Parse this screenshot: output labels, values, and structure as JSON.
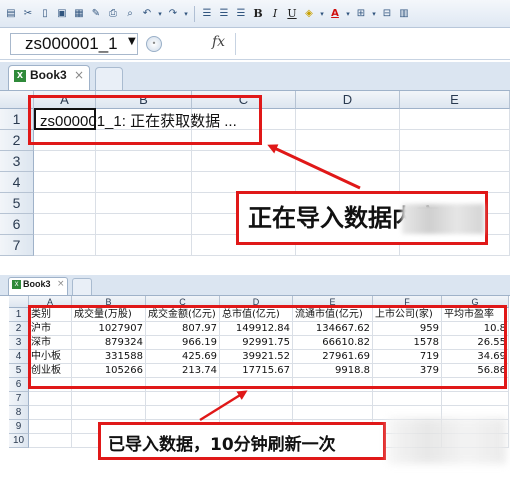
{
  "toolbar": {
    "icons": [
      "paste-icon",
      "cut-icon",
      "new-icon",
      "save-icon",
      "print-preview-icon",
      "format-painter-icon",
      "print-icon",
      "preview-icon",
      "undo-icon",
      "redo-icon",
      "align-left-icon",
      "align-center-icon",
      "align-right-icon",
      "bold-icon",
      "italic-icon",
      "underline-icon",
      "fill-color-icon",
      "font-color-icon",
      "borders-icon",
      "merge-icon",
      "more-icon"
    ],
    "bold": "B",
    "italic": "I",
    "underline": "U",
    "font_color_letter": "A"
  },
  "formula_bar": {
    "name_box": "zs000001_1",
    "fx": "fx",
    "formula": ""
  },
  "top_window": {
    "tab_label": "Book3",
    "tab_close": "×",
    "columns": [
      "A",
      "B",
      "C",
      "D",
      "E"
    ],
    "rows": [
      "1",
      "2",
      "3",
      "4",
      "5",
      "6",
      "7"
    ],
    "cell_text": "zs000001_1: 正在获取数据 ...",
    "callout": "正在导入数据内容"
  },
  "bottom_window": {
    "tab_label": "Book3",
    "tab_close": "×",
    "columns": [
      "A",
      "B",
      "C",
      "D",
      "E",
      "F",
      "G"
    ],
    "rows": [
      "1",
      "2",
      "3",
      "4",
      "5",
      "6",
      "7",
      "8",
      "9",
      "10"
    ],
    "headers": [
      "类别",
      "成交量(万股)",
      "成交金额(亿元)",
      "总市值(亿元)",
      "流通市值(亿元)",
      "上市公司(家)",
      "平均市盈率"
    ],
    "data": [
      [
        "沪市",
        "1027907",
        "807.97",
        "149912.84",
        "134667.62",
        "959",
        "10.8"
      ],
      [
        "深市",
        "879324",
        "966.19",
        "92991.75",
        "66610.82",
        "1578",
        "26.55"
      ],
      [
        "中小板",
        "331588",
        "425.69",
        "39921.52",
        "27961.69",
        "719",
        "34.69"
      ],
      [
        "创业板",
        "105266",
        "213.74",
        "17715.67",
        "9918.8",
        "379",
        "56.86"
      ]
    ],
    "callout": "已导入数据，10分钟刷新一次"
  },
  "colors": {
    "highlight_red": "#e01818",
    "header_bg": "#dde6f0",
    "sheet_icon_green": "#2f8a3a"
  }
}
